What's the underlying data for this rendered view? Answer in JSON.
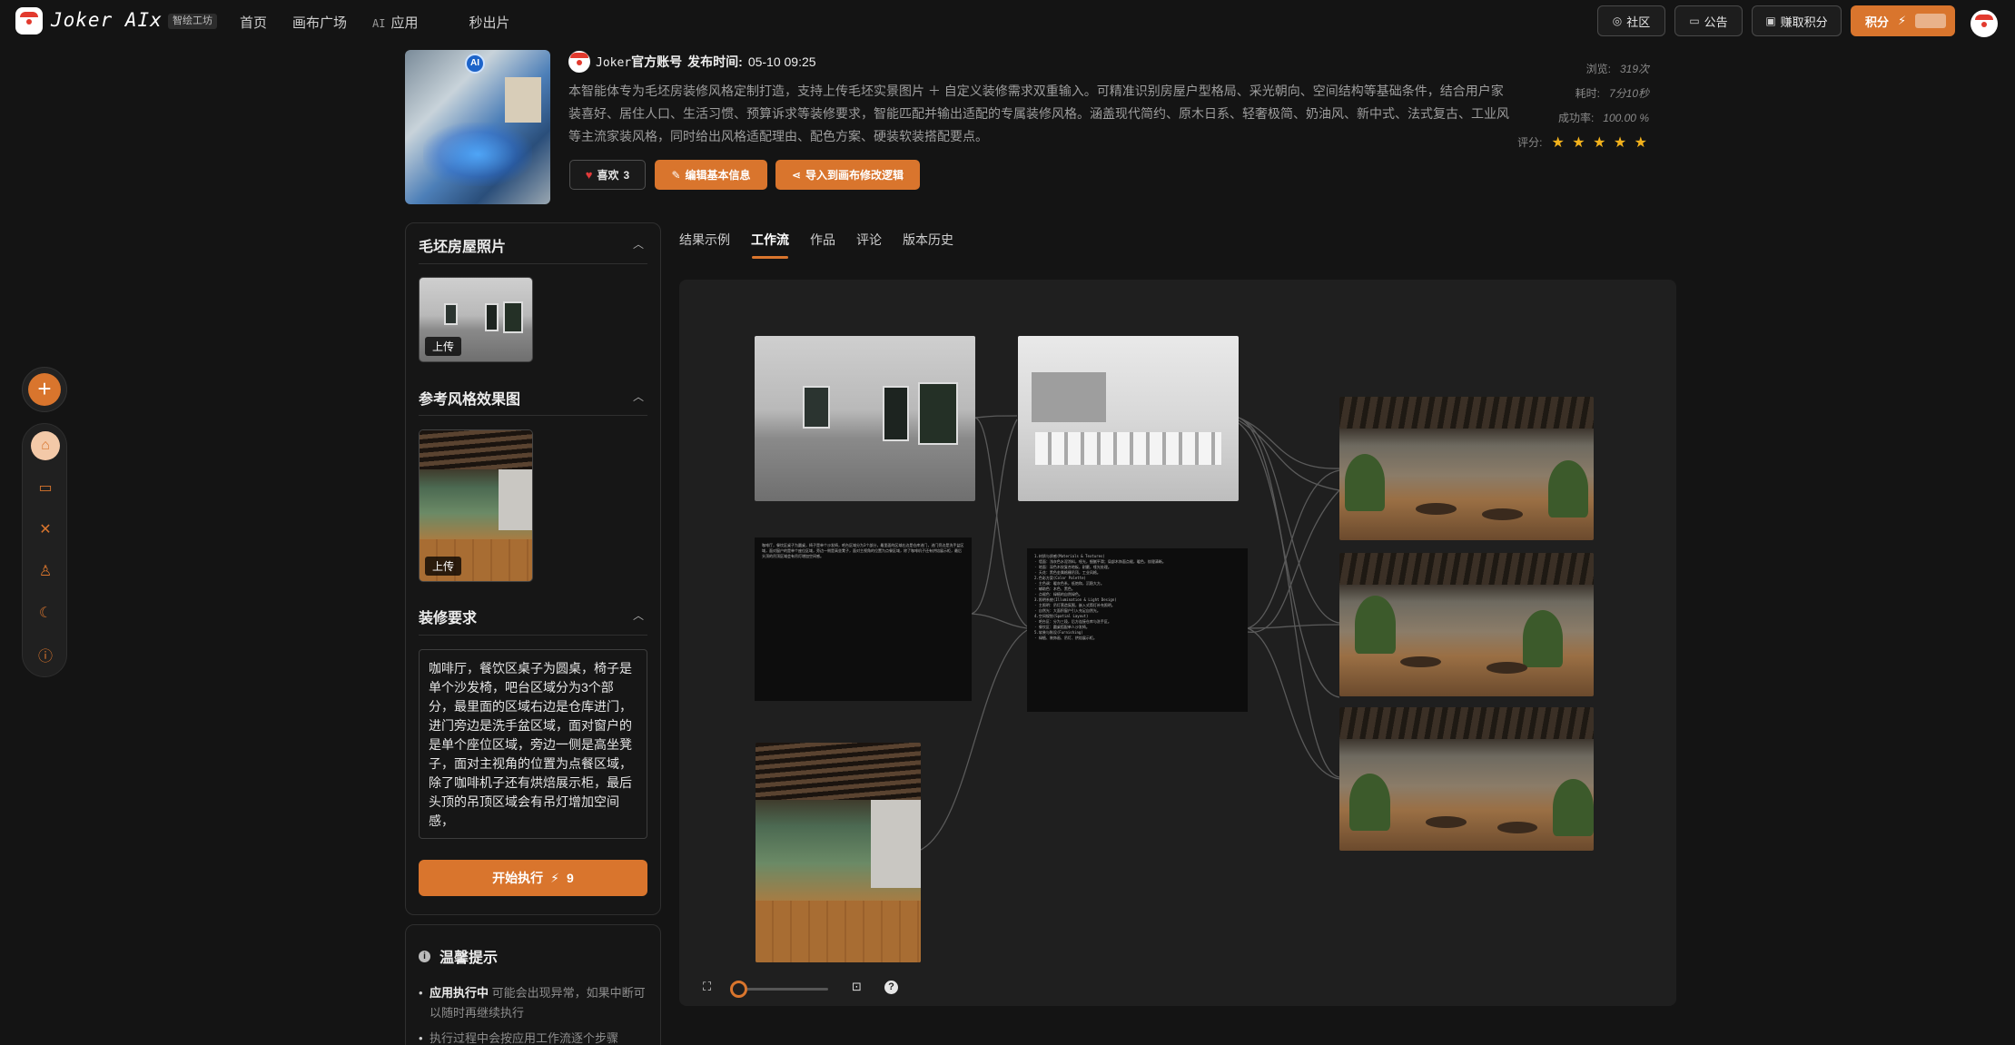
{
  "header": {
    "brand": "Joker AIx",
    "brand_tag": "智绘工坊",
    "nav": [
      {
        "label": "首页"
      },
      {
        "label": "画布广场"
      },
      {
        "prefix": "AI",
        "label": "应用"
      },
      {
        "label": "秒出片"
      }
    ],
    "community": "社区",
    "announcement": "公告",
    "earn_points": "赚取积分",
    "points": "积分",
    "points_icon": "⚡"
  },
  "app": {
    "author": "Joker官方账号",
    "author_name": "Joker",
    "author_suffix": "官方账号",
    "publish_label": "发布时间:",
    "publish_time": "05-10 09:25",
    "description": "本智能体专为毛坯房装修风格定制打造，支持上传毛坯实景图片 ＋ 自定义装修需求双重输入。可精准识别房屋户型格局、采光朝向、空间结构等基础条件，结合用户家装喜好、居住人口、生活习惯、预算诉求等装修要求，智能匹配并输出适配的专属装修风格。涵盖现代简约、原木日系、轻奢极简、奶油风、新中式、法式复古、工业风等主流家装风格，同时给出风格适配理由、配色方案、硬装软装搭配要点。",
    "like_label": "喜欢",
    "like_count": "3",
    "edit_label": "编辑基本信息",
    "import_label": "导入到画布修改逻辑",
    "stats": {
      "views_label": "浏览:",
      "views": "319次",
      "time_label": "耗时:",
      "time": "7分10秒",
      "success_label": "成功率:",
      "success": "100.00 %",
      "rating_label": "评分:",
      "rating": 5,
      "stars": "★ ★ ★ ★ ★"
    }
  },
  "panel": {
    "section1": "毛坯房屋照片",
    "section2": "参考风格效果图",
    "section3": "装修要求",
    "upload_label": "上传",
    "requirements": "咖啡厅，餐饮区桌子为圆桌，椅子是单个沙发椅，吧台区域分为3个部分，最里面的区域右边是仓库进门，进门旁边是洗手盆区域，面对窗户的是单个座位区域，旁边一侧是高坐凳子，面对主视角的位置为点餐区域，除了咖啡机子还有烘焙展示柜，最后头顶的吊顶区域会有吊灯增加空间感，",
    "run_label": "开始执行",
    "run_cost": "9",
    "run_icon": "⚡"
  },
  "tips": {
    "title": "温馨提示",
    "tip1_bold": "应用执行中",
    "tip1_text": "可能会出现异常，如果中断可以随时再继续执行",
    "tip2_text": "执行过程中会按应用工作流逐个步骤"
  },
  "tabs": [
    {
      "label": "结果示例",
      "active": false
    },
    {
      "label": "工作流",
      "active": true
    },
    {
      "label": "作品",
      "active": false
    },
    {
      "label": "评论",
      "active": false
    },
    {
      "label": "版本历史",
      "active": false
    }
  ],
  "canvas": {
    "prompt_text": "咖啡厅，餐饮区桌子为圆桌，椅子是单个沙发椅，吧台区域分为3个部分，最里面的区域右边是仓库进门，进门旁边是洗手盆区域，面对窗户的是单个座位区域，旁边一侧是高坐凳子，面对主视角的位置为点餐区域，除了咖啡机子还有烘焙展示柜，最后头顶的吊顶区域会有吊灯增加空间感。",
    "analysis_lines": [
      "1.材质与质感(Materials & Textures)",
      "· 墙面：浅灰色水泥涂料，哑光，细腻平滑；局部木饰面点缀，暖色，纹理清晰。",
      "· 地面：深色木纹复合地板，耐磨，哑光处理。",
      "· 天花：黑色金属格栅吊顶，工业风格。",
      "2.色彩方案(Color Palette)",
      "· 主色调：暖灰色系，低饱和，沉稳大方。",
      "· 辅助色：木色、黑色。",
      "· 点缀色：绿植的自然绿色。",
      "3.照明系统(Illumination & Light Design)",
      "· 主照明：吊灯营造氛围，嵌入式筒灯补充照明。",
      "· 自然光：大面积窗户引入充足自然光。",
      "4.空间规划(Spatial Layout)",
      "· 吧台区：分为三段，后方连接仓库与洗手区。",
      "· 餐饮区：圆桌搭配单人沙发椅。",
      "5.软装与陈设(Furnishing)",
      "· 绿植、装饰画、吊灯、烘焙展示柜。"
    ],
    "zoom_value": 0.05
  },
  "colors": {
    "accent": "#d9752d",
    "background": "#141414",
    "panel": "#161616",
    "canvas": "#1f1f1f",
    "star": "#f3b21c"
  }
}
